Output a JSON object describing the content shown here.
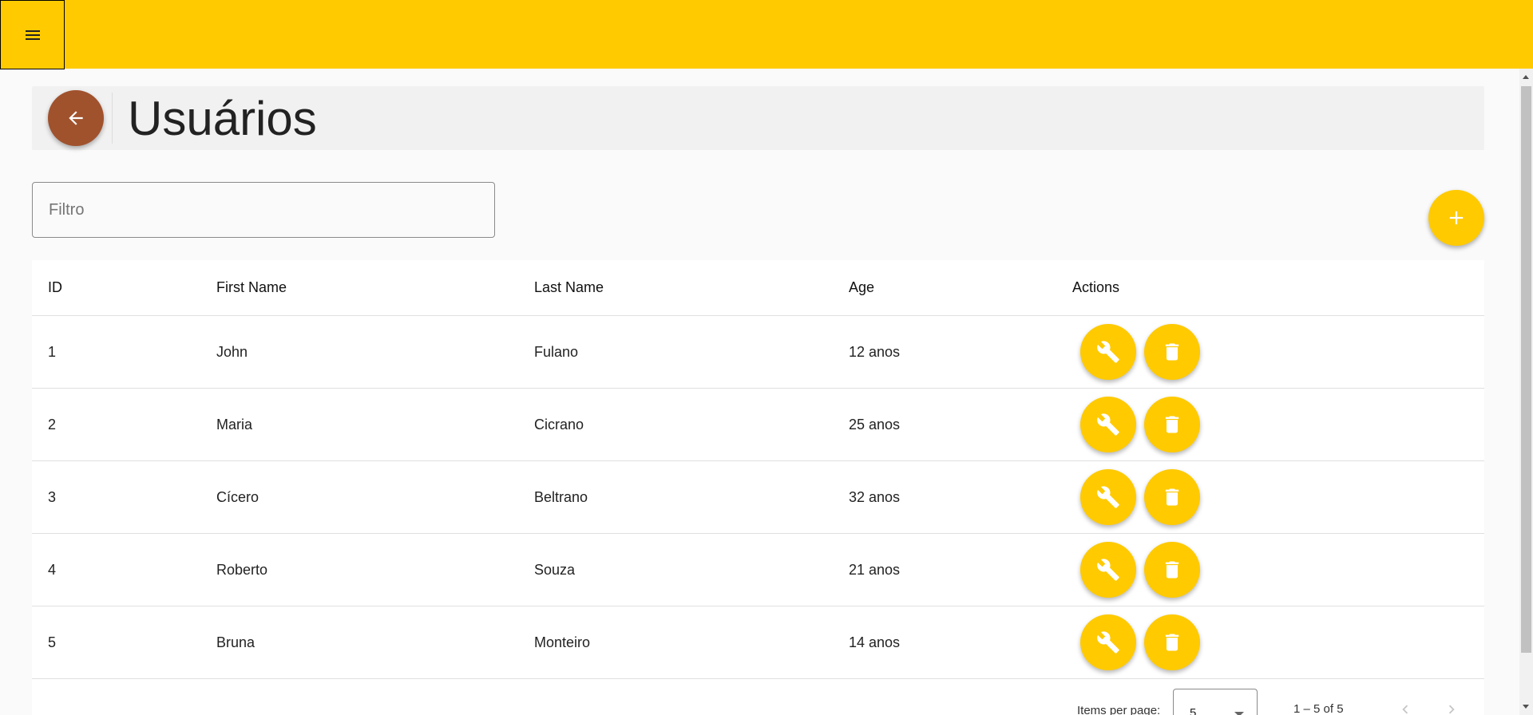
{
  "header": {
    "title": "Usuários"
  },
  "icons": {
    "menu": "menu-icon",
    "back": "arrow-left-icon",
    "add": "plus-icon",
    "edit": "wrench-icon",
    "delete": "trash-icon",
    "prev": "chevron-left-icon",
    "next": "chevron-right-icon"
  },
  "colors": {
    "accent": "#ffca00",
    "back_button": "#a0522d"
  },
  "filter": {
    "placeholder": "Filtro",
    "value": ""
  },
  "table": {
    "columns": {
      "id": "ID",
      "first_name": "First Name",
      "last_name": "Last Name",
      "age": "Age",
      "actions": "Actions"
    },
    "rows": [
      {
        "id": "1",
        "first_name": "John",
        "last_name": "Fulano",
        "age": "12 anos"
      },
      {
        "id": "2",
        "first_name": "Maria",
        "last_name": "Cicrano",
        "age": "25 anos"
      },
      {
        "id": "3",
        "first_name": "Cícero",
        "last_name": "Beltrano",
        "age": "32 anos"
      },
      {
        "id": "4",
        "first_name": "Roberto",
        "last_name": "Souza",
        "age": "21 anos"
      },
      {
        "id": "5",
        "first_name": "Bruna",
        "last_name": "Monteiro",
        "age": "14 anos"
      }
    ]
  },
  "paginator": {
    "items_per_page_label": "Items per page:",
    "page_size": "5",
    "range_label": "1 – 5 of 5"
  }
}
